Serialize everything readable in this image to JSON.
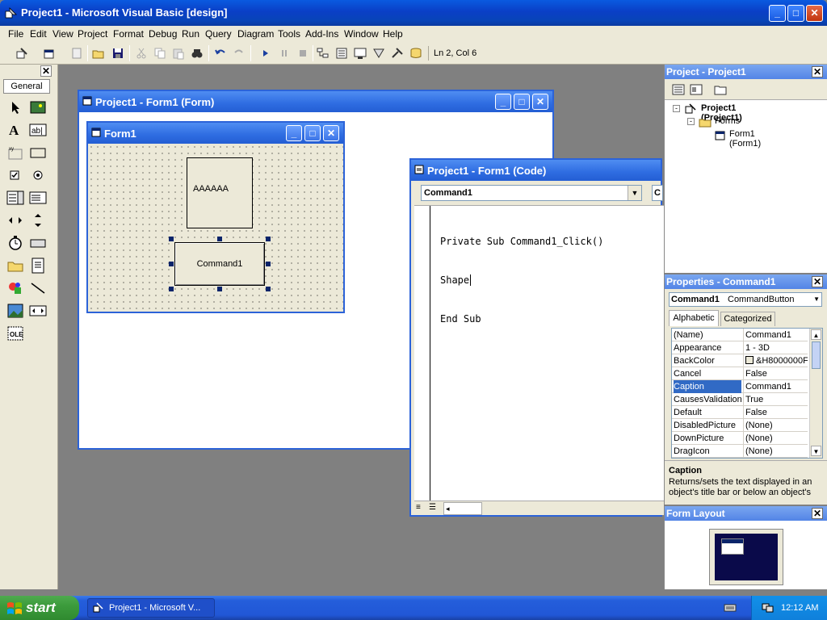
{
  "window": {
    "title": "Project1 - Microsoft Visual Basic [design]",
    "minimize": "_",
    "maximize": "□",
    "close": "✕"
  },
  "menu": [
    "File",
    "Edit",
    "View",
    "Project",
    "Format",
    "Debug",
    "Run",
    "Query",
    "Diagram",
    "Tools",
    "Add-Ins",
    "Window",
    "Help"
  ],
  "toolbar": {
    "position": "Ln 2, Col 6"
  },
  "toolbox": {
    "tab": "General",
    "close": "✕"
  },
  "form_designer": {
    "title": "Project1 - Form1 (Form)",
    "form_title": "Form1",
    "label_text": "AAAAAA",
    "button_text": "Command1"
  },
  "code_window": {
    "title": "Project1 - Form1 (Code)",
    "object_combo": "Command1",
    "proc_combo": "C",
    "lines": [
      "Private Sub Command1_Click()",
      "Shape",
      "End Sub"
    ]
  },
  "project_pane": {
    "title": "Project - Project1",
    "tree": {
      "root": "Project1 (Project1)",
      "folder": "Forms",
      "item": "Form1 (Form1)"
    }
  },
  "properties_pane": {
    "title": "Properties - Command1",
    "object_name": "Command1",
    "object_type": "CommandButton",
    "tabs": [
      "Alphabetic",
      "Categorized"
    ],
    "rows": [
      {
        "name": "(Name)",
        "value": "Command1"
      },
      {
        "name": "Appearance",
        "value": "1 - 3D"
      },
      {
        "name": "BackColor",
        "value": "&H8000000F"
      },
      {
        "name": "Cancel",
        "value": "False"
      },
      {
        "name": "Caption",
        "value": "Command1"
      },
      {
        "name": "CausesValidation",
        "value": "True"
      },
      {
        "name": "Default",
        "value": "False"
      },
      {
        "name": "DisabledPicture",
        "value": "(None)"
      },
      {
        "name": "DownPicture",
        "value": "(None)"
      },
      {
        "name": "DragIcon",
        "value": "(None)"
      }
    ],
    "selected_row": "Caption",
    "desc_title": "Caption",
    "desc_text": "Returns/sets the text displayed in an object's title bar or below an object's"
  },
  "form_layout_pane": {
    "title": "Form Layout"
  },
  "taskbar": {
    "start": "start",
    "item": "Project1 - Microsoft V...",
    "clock": "12:12 AM"
  }
}
